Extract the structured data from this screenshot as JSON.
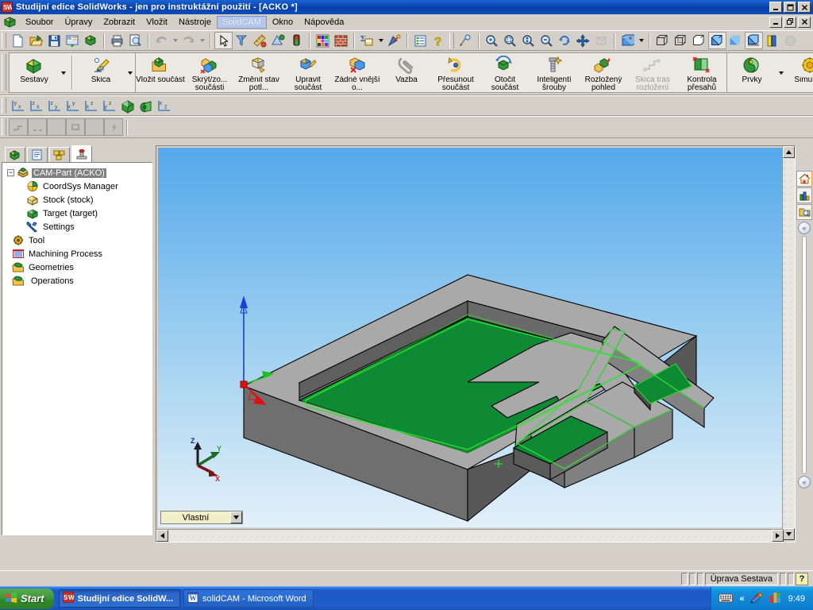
{
  "window": {
    "title": "Studijní edice SolidWorks - jen pro instruktážní použití - [ACKO *]",
    "app_icon": "solidworks-logo-icon",
    "minimize": "minimize-icon",
    "maximize": "maximize-icon",
    "close": "close-icon"
  },
  "menu": {
    "items": [
      {
        "label": "Soubor",
        "selected": false
      },
      {
        "label": "Úpravy",
        "selected": false
      },
      {
        "label": "Zobrazit",
        "selected": false
      },
      {
        "label": "Vložit",
        "selected": false
      },
      {
        "label": "Nástroje",
        "selected": false
      },
      {
        "label": "SolidCAM",
        "selected": true
      },
      {
        "label": "Okno",
        "selected": false
      },
      {
        "label": "Nápověda",
        "selected": false
      }
    ]
  },
  "standard_toolbar": {
    "buttons": [
      {
        "name": "new-document-icon",
        "enabled": true
      },
      {
        "name": "open-document-icon",
        "enabled": true
      },
      {
        "name": "save-icon",
        "enabled": true
      },
      {
        "name": "make-drawing-icon",
        "enabled": true
      },
      {
        "name": "make-assembly-icon",
        "enabled": true
      },
      {
        "name": "print-icon",
        "enabled": true
      },
      {
        "name": "print-preview-icon",
        "enabled": true
      },
      {
        "name": "undo-icon",
        "enabled": false
      },
      {
        "name": "redo-icon",
        "enabled": false
      },
      {
        "name": "select-arrow-icon",
        "enabled": true,
        "pressed": true
      },
      {
        "name": "select-filter-icon",
        "enabled": true
      },
      {
        "name": "measure-icon",
        "enabled": true
      },
      {
        "name": "mass-properties-icon",
        "enabled": true
      },
      {
        "name": "traffic-light-icon",
        "enabled": true
      },
      {
        "name": "colors-icon",
        "enabled": true
      },
      {
        "name": "texture-icon",
        "enabled": true
      },
      {
        "name": "equations-icon",
        "enabled": true
      },
      {
        "name": "appearance-icon",
        "enabled": true
      },
      {
        "name": "options-icon",
        "enabled": true
      },
      {
        "name": "help-icon",
        "enabled": true
      },
      {
        "name": "zoom-pan-tool-icon",
        "enabled": true
      },
      {
        "name": "zoom-to-fit-icon",
        "enabled": true
      },
      {
        "name": "zoom-to-area-icon",
        "enabled": true
      },
      {
        "name": "zoom-in-out-icon",
        "enabled": true
      },
      {
        "name": "zoom-to-selection-icon",
        "enabled": true
      },
      {
        "name": "rotate-view-icon",
        "enabled": true
      },
      {
        "name": "pan-icon",
        "enabled": true
      },
      {
        "name": "previous-view-icon",
        "enabled": false
      },
      {
        "name": "view-orientation-icon",
        "enabled": true
      },
      {
        "name": "wireframe-icon",
        "enabled": true
      },
      {
        "name": "hidden-lines-visible-icon",
        "enabled": true
      },
      {
        "name": "hidden-lines-removed-icon",
        "enabled": true
      },
      {
        "name": "shaded-with-edges-icon",
        "enabled": true,
        "pressed": true
      },
      {
        "name": "shaded-icon",
        "enabled": true
      },
      {
        "name": "shadows-icon",
        "enabled": true,
        "pressed": true
      },
      {
        "name": "section-view-icon",
        "enabled": true
      },
      {
        "name": "realview-icon",
        "enabled": false
      }
    ]
  },
  "command_manager": {
    "groups": [
      {
        "name": "assembly-group",
        "buttons": [
          {
            "label": "Sestavy",
            "icon": "assembly-icon",
            "enabled": true,
            "has_dropdown": true
          },
          {
            "label": "Skica",
            "icon": "sketch-icon",
            "enabled": true,
            "has_dropdown": true
          }
        ]
      },
      {
        "name": "assembly-tools-group",
        "buttons": [
          {
            "label": "Vložit součást",
            "icon": "insert-component-icon",
            "enabled": true
          },
          {
            "label": "Skrýt/zo... součásti",
            "icon": "hide-show-components-icon",
            "enabled": true
          },
          {
            "label": "Změnit stav potl...",
            "icon": "change-suppression-icon",
            "enabled": true
          },
          {
            "label": "Upravit součást",
            "icon": "edit-component-icon",
            "enabled": true
          },
          {
            "label": "Žádné vnější o...",
            "icon": "no-external-references-icon",
            "enabled": true
          },
          {
            "label": "Vazba",
            "icon": "mate-icon",
            "enabled": true
          },
          {
            "label": "Přesunout součást",
            "icon": "move-component-icon",
            "enabled": true
          },
          {
            "label": "Otočit součást",
            "icon": "rotate-component-icon",
            "enabled": true
          },
          {
            "label": "Inteligentí šrouby",
            "icon": "smart-fasteners-icon",
            "enabled": true
          },
          {
            "label": "Rozložený pohled",
            "icon": "exploded-view-icon",
            "enabled": true
          },
          {
            "label": "Skica tras rozložení",
            "icon": "explode-line-sketch-icon",
            "enabled": false
          },
          {
            "label": "Kontrola přesahů",
            "icon": "interference-detection-icon",
            "enabled": true
          }
        ]
      },
      {
        "name": "features-group",
        "buttons": [
          {
            "label": "Prvky",
            "icon": "features-icon",
            "enabled": true,
            "has_dropdown": true
          },
          {
            "label": "Simulace",
            "icon": "simulation-icon",
            "enabled": true,
            "has_dropdown": true
          }
        ]
      }
    ]
  },
  "view_toolbar": {
    "buttons": [
      {
        "name": "front-view-icon",
        "label": "y x"
      },
      {
        "name": "top-view-icon",
        "label": "z x"
      },
      {
        "name": "right-view-icon",
        "label": "z y"
      },
      {
        "name": "back-view-icon",
        "label": "x y"
      },
      {
        "name": "bottom-view-icon",
        "label": "x z"
      },
      {
        "name": "left-view-icon",
        "label": "y z"
      },
      {
        "name": "isometric-view-icon",
        "label": ""
      },
      {
        "name": "trimetric-view-icon",
        "label": ""
      },
      {
        "name": "normal-to-icon",
        "label": "x z"
      }
    ]
  },
  "disabled_toolbar": {
    "buttons": [
      {
        "name": "sketch-entity-icon"
      },
      {
        "name": "sketch-line-icon"
      },
      {
        "name": "sketch-blank-icon"
      },
      {
        "name": "sketch-plane-icon"
      },
      {
        "name": "sketch-empty-icon"
      },
      {
        "name": "sketch-flash-icon"
      }
    ]
  },
  "feature_tree": {
    "tabs": [
      {
        "name": "feature-manager-tab",
        "active": false
      },
      {
        "name": "property-manager-tab",
        "active": false
      },
      {
        "name": "configuration-manager-tab",
        "active": false
      },
      {
        "name": "solidcam-manager-tab",
        "active": true
      }
    ],
    "nodes": [
      {
        "label": "CAM-Part (ACKO)",
        "icon": "cam-part-icon",
        "depth": 0,
        "selected": true,
        "expander": "-"
      },
      {
        "label": "CoordSys Manager",
        "icon": "coordsys-icon",
        "depth": 1,
        "selected": false
      },
      {
        "label": "Stock (stock)",
        "icon": "stock-icon",
        "depth": 1,
        "selected": false
      },
      {
        "label": "Target (target)",
        "icon": "target-icon",
        "depth": 1,
        "selected": false
      },
      {
        "label": "Settings",
        "icon": "settings-wrench-icon",
        "depth": 1,
        "selected": false
      },
      {
        "label": "Tool",
        "icon": "tool-gear-icon",
        "depth": 0,
        "selected": false
      },
      {
        "label": "Machining Process",
        "icon": "machining-process-icon",
        "depth": 0,
        "selected": false
      },
      {
        "label": "Geometries",
        "icon": "geometries-icon",
        "depth": 0,
        "selected": false
      },
      {
        "label": "Operations",
        "icon": "operations-icon",
        "depth": 0,
        "selected": false
      }
    ]
  },
  "graphics": {
    "configuration_combo": {
      "value": "Vlastní",
      "dropdown_icon": "chevron-down-icon"
    },
    "triad": {
      "x_label": "X",
      "y_label": "Y",
      "z_label": "Z"
    },
    "model": {
      "description": "Shaded 3D CAM part: rectangular stock block with a pocketed A-shaped target face",
      "stock_top_color": "#a8a8a8",
      "stock_side_color": "#6e6e6e",
      "pocket_floor_color": "#0e8a34",
      "toolpath_color": "#35e035",
      "edge_color": "#000000"
    }
  },
  "task_pane": {
    "tabs": [
      {
        "name": "home-icon",
        "active": true
      },
      {
        "name": "design-library-icon",
        "active": false
      },
      {
        "name": "file-explorer-icon",
        "active": false
      }
    ],
    "collapse_top": "«",
    "collapse_bottom": "«"
  },
  "status_bar": {
    "text": "Úprava Sestava",
    "help_icon": "help-question-icon"
  },
  "taskbar": {
    "start_label": "Start",
    "start_icon": "windows-flag-icon",
    "tasks": [
      {
        "label": "Studijní edice SolidW...",
        "icon": "solidworks-logo-icon",
        "active": true
      },
      {
        "label": "solidCAM - Microsoft Word",
        "icon": "word-icon",
        "active": false
      }
    ],
    "tray": {
      "keyboard_icon": "keyboard-icon",
      "expand_chevron": "«",
      "icons": [
        "graphics-tool-icon",
        "color-palette-icon"
      ],
      "time": "9:49"
    }
  }
}
